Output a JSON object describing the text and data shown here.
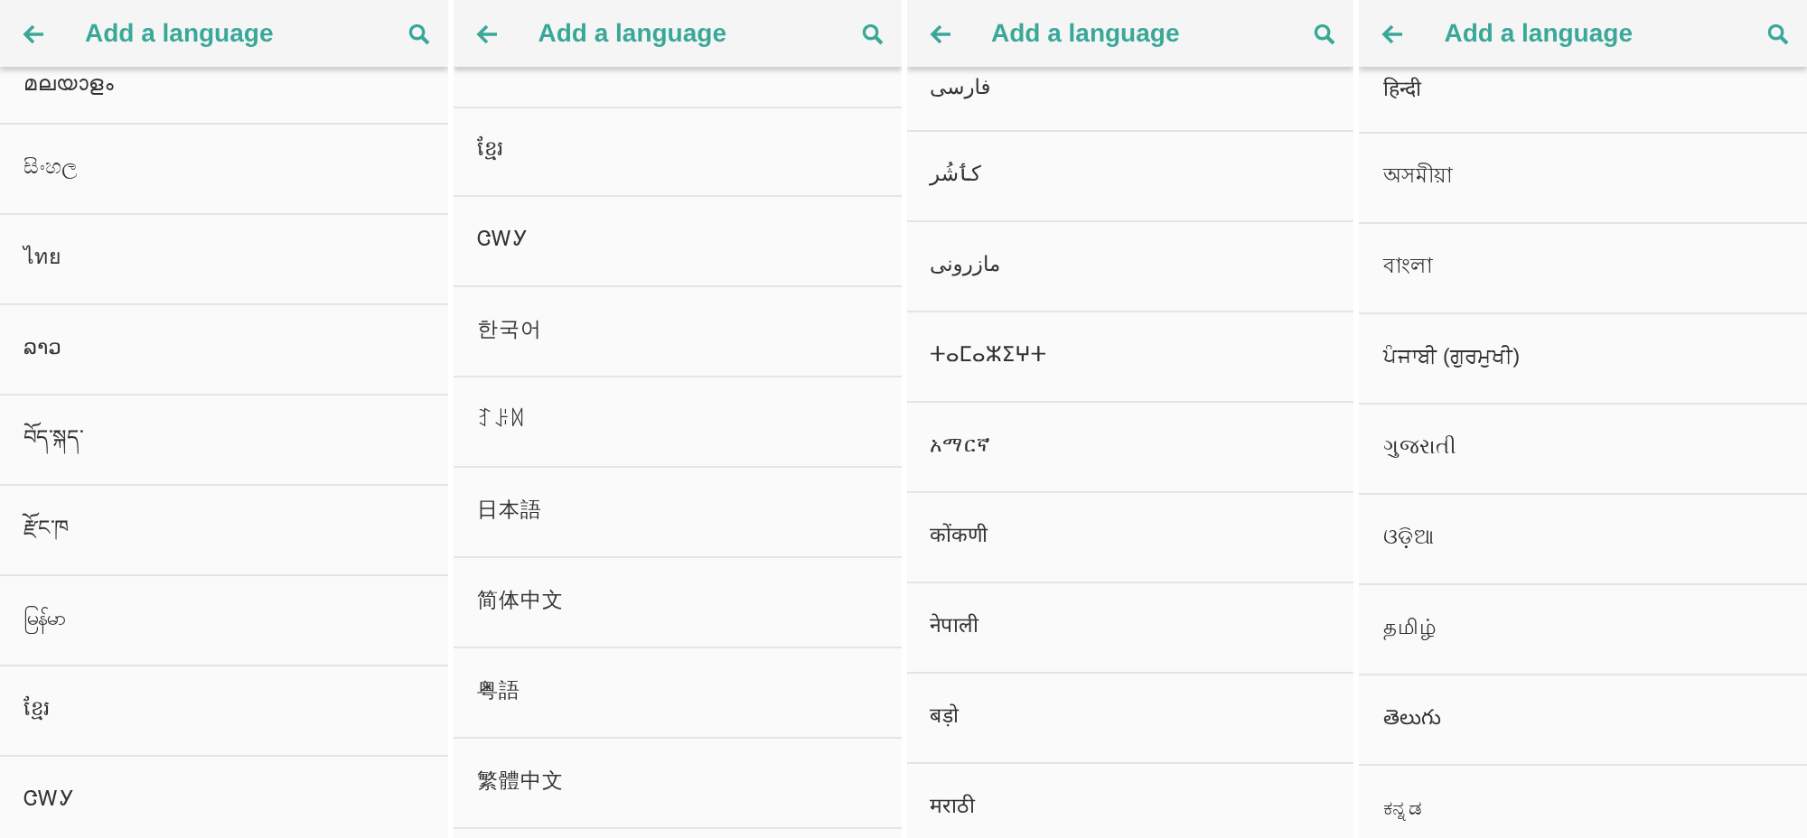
{
  "screens": [
    {
      "title": "Add a language",
      "languages": [
        "മലയാളം",
        "සිංහල",
        "ไทย",
        "ລາວ",
        "བོད་སྐད་",
        "རྫོང་ཁ",
        "မြန်မာ",
        "ខ្មែរ",
        "ᏣᎳᎩ"
      ]
    },
    {
      "title": "Add a language",
      "languages": [
        "ខ្មែរ",
        "ᏣᎳᎩ",
        "한국어",
        "ꆈꌠꉙ",
        "日本語",
        "简体中文",
        "粤語",
        "繁體中文"
      ]
    },
    {
      "title": "Add a language",
      "languages": [
        "فارسی",
        "کٲشُر",
        "مازرونی",
        "ⵜⴰⵎⴰⵣⵉⵖⵜ",
        "አማርኛ",
        "कोंकणी",
        "नेपाली",
        "बड़ो",
        "मराठी"
      ]
    },
    {
      "title": "Add a language",
      "languages": [
        "हिन्दी",
        "অসমীয়া",
        "বাংলা",
        "ਪੰਜਾਬੀ (ਗੁਰਮੁਖੀ)",
        "ગુજરાતી",
        "ଓଡ଼ିଆ",
        "தமிழ்",
        "తెలుగు",
        "ಕನ್ನಡ"
      ]
    }
  ]
}
